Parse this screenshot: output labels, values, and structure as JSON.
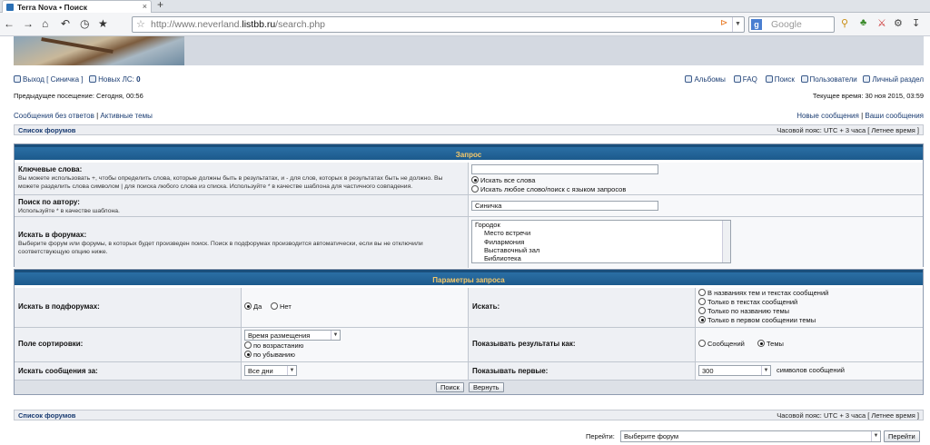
{
  "browser": {
    "tab_title": "Terra Nova • Поиск",
    "tab_close": "×",
    "new_tab": "+",
    "url_host_pre": "http://www.neverland.",
    "url_host": "listbb.ru",
    "url_path": "/search.php",
    "search_engine_placeholder": "Google",
    "nav_icons": [
      "back-icon",
      "forward-icon",
      "home-icon",
      "undo-icon",
      "history-icon",
      "bookmark-star-icon"
    ]
  },
  "top": {
    "logout": "Выход [ Синичка ]",
    "new_pm_label": "Новых ЛС:",
    "new_pm_count": "0",
    "albums": "Альбомы",
    "faq": "FAQ",
    "search": "Поиск",
    "users": "Пользователи",
    "personal": "Личный раздел"
  },
  "visit": {
    "last_visit": "Предыдущее посещение: Сегодня, 00:56",
    "current_time": "Текущее время: 30 ноя 2015, 03:59"
  },
  "links": {
    "unanswered": "Сообщения без ответов",
    "sep": " | ",
    "active": "Активные темы",
    "new_posts": "Новые сообщения",
    "your_posts": "Ваши сообщения"
  },
  "crumb": {
    "forum_list": "Список форумов",
    "timezone": "Часовой пояс: UTC + 3 часа [ Летнее время ]"
  },
  "query": {
    "header": "Запрос",
    "keywords_label": "Ключевые слова:",
    "keywords_help": "Вы можете использовать +, чтобы определить слова, которые должны быть в результатах, и - для слов, которых в результатах быть не должно. Вы можете разделить слова символом | для поиска любого слова из списка. Используйте * в качестве шаблона для частичного совпадения.",
    "keywords_value": "",
    "match_all": "Искать все слова",
    "match_any": "Искать любое слово/поиск с языком запросов",
    "author_label": "Поиск по автору:",
    "author_help": "Используйте * в качестве шаблона.",
    "author_value": "Синичка",
    "forums_label": "Искать в форумах:",
    "forums_help": "Выберите форум или форумы, в которых будет произведен поиск. Поиск в подфорумах производится автоматически, если вы не отключили соответствующую опцию ниже.",
    "forums": [
      "Городок",
      "Место встречи",
      "Филармония",
      "Выставочный зал",
      "Библиотека"
    ]
  },
  "params": {
    "header": "Параметры запроса",
    "subforums_label": "Искать в подфорумах:",
    "yes": "Да",
    "no": "Нет",
    "search_in_label": "Искать:",
    "search_in_opts": [
      "В названиях тем и текстах сообщений",
      "Только в текстах сообщений",
      "Только по названию темы",
      "Только в первом сообщении темы"
    ],
    "sort_label": "Поле сортировки:",
    "sort_field": "Время размещения",
    "asc": "по возрастанию",
    "desc": "по убыванию",
    "show_as_label": "Показывать результаты как:",
    "posts": "Сообщений",
    "topics": "Темы",
    "period_label": "Искать сообщения за:",
    "period_value": "Все дни",
    "show_first_label": "Показывать первые:",
    "show_first_value": "300",
    "chars_label": "символов сообщений",
    "search_btn": "Поиск",
    "reset_btn": "Вернуть"
  },
  "jump": {
    "label": "Перейти:",
    "placeholder": "Выберите форум",
    "go_btn": "Перейти"
  }
}
